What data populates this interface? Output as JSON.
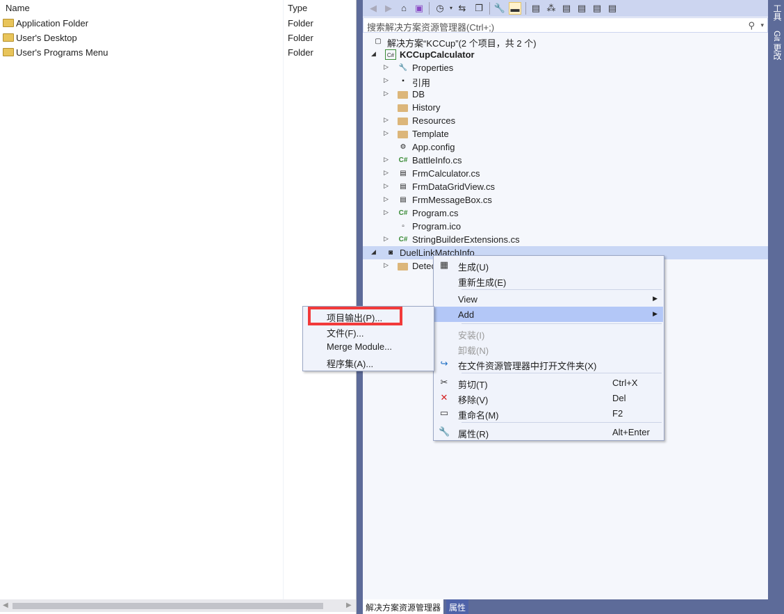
{
  "left_pane": {
    "columns": {
      "name": "Name",
      "type": "Type"
    },
    "rows": [
      {
        "name": "Application Folder",
        "type": "Folder"
      },
      {
        "name": "User's Desktop",
        "type": "Folder"
      },
      {
        "name": "User's Programs Menu",
        "type": "Folder"
      }
    ]
  },
  "solution_explorer": {
    "search_placeholder": "搜索解决方案资源管理器(Ctrl+;)",
    "tree": [
      {
        "label": "解决方案“KCCup”(2 个项目，共 2 个)",
        "icon": "solution-icon",
        "level": 0,
        "expander": ""
      },
      {
        "label": "KCCupCalculator",
        "icon": "csharp-project-icon",
        "level": 0,
        "expander": "◢",
        "bold": true
      },
      {
        "label": "Properties",
        "icon": "wrench-icon",
        "level": 1,
        "expander": "▷"
      },
      {
        "label": "引用",
        "icon": "references-icon",
        "level": 1,
        "expander": "▷"
      },
      {
        "label": "DB",
        "icon": "folder-icon",
        "level": 1,
        "expander": "▷"
      },
      {
        "label": "History",
        "icon": "folder-icon",
        "level": 1,
        "expander": ""
      },
      {
        "label": "Resources",
        "icon": "folder-icon",
        "level": 1,
        "expander": "▷"
      },
      {
        "label": "Template",
        "icon": "folder-icon",
        "level": 1,
        "expander": "▷"
      },
      {
        "label": "App.config",
        "icon": "config-file-icon",
        "level": 1,
        "expander": ""
      },
      {
        "label": "BattleInfo.cs",
        "icon": "csharp-file-icon",
        "level": 1,
        "expander": "▷"
      },
      {
        "label": "FrmCalculator.cs",
        "icon": "form-icon",
        "level": 1,
        "expander": "▷"
      },
      {
        "label": "FrmDataGridView.cs",
        "icon": "form-icon",
        "level": 1,
        "expander": "▷"
      },
      {
        "label": "FrmMessageBox.cs",
        "icon": "form-icon",
        "level": 1,
        "expander": "▷"
      },
      {
        "label": "Program.cs",
        "icon": "csharp-file-icon",
        "level": 1,
        "expander": "▷"
      },
      {
        "label": "Program.ico",
        "icon": "icon-file-icon",
        "level": 1,
        "expander": ""
      },
      {
        "label": "StringBuilderExtensions.cs",
        "icon": "csharp-file-icon",
        "level": 1,
        "expander": "▷"
      },
      {
        "label": "DuelLinkMatchInfo",
        "icon": "setup-project-icon",
        "level": 0,
        "expander": "◢",
        "selected": true
      },
      {
        "label": "Detec",
        "icon": "folder-icon",
        "level": 1,
        "expander": "▷"
      }
    ],
    "bottom_tabs": [
      "解决方案资源管理器",
      "属性"
    ]
  },
  "right_strip": [
    "工具",
    "Git 更改"
  ],
  "context_menu": [
    {
      "label": "生成(U)",
      "icon": "build-icon"
    },
    {
      "label": "重新生成(E)"
    },
    {
      "sep": true
    },
    {
      "label": "View",
      "submenu": true
    },
    {
      "label": "Add",
      "submenu": true,
      "highlighted": true
    },
    {
      "sep": true
    },
    {
      "label": "安装(I)",
      "disabled": true
    },
    {
      "label": "卸载(N)",
      "disabled": true
    },
    {
      "label": "在文件资源管理器中打开文件夹(X)",
      "icon": "open-folder-arrow-icon"
    },
    {
      "sep": true
    },
    {
      "label": "剪切(T)",
      "shortcut": "Ctrl+X",
      "icon": "scissors-icon"
    },
    {
      "label": "移除(V)",
      "shortcut": "Del",
      "icon": "remove-x-icon"
    },
    {
      "label": "重命名(M)",
      "shortcut": "F2",
      "icon": "rename-icon"
    },
    {
      "sep": true
    },
    {
      "label": "属性(R)",
      "shortcut": "Alt+Enter",
      "icon": "wrench-icon"
    }
  ],
  "add_submenu": [
    "项目输出(P)...",
    "文件(F)...",
    "Merge Module...",
    "程序集(A)..."
  ],
  "colors": {
    "accent": "#5d6b99",
    "highlight": "#b3c7f7",
    "annotation": "#f23a3a"
  }
}
